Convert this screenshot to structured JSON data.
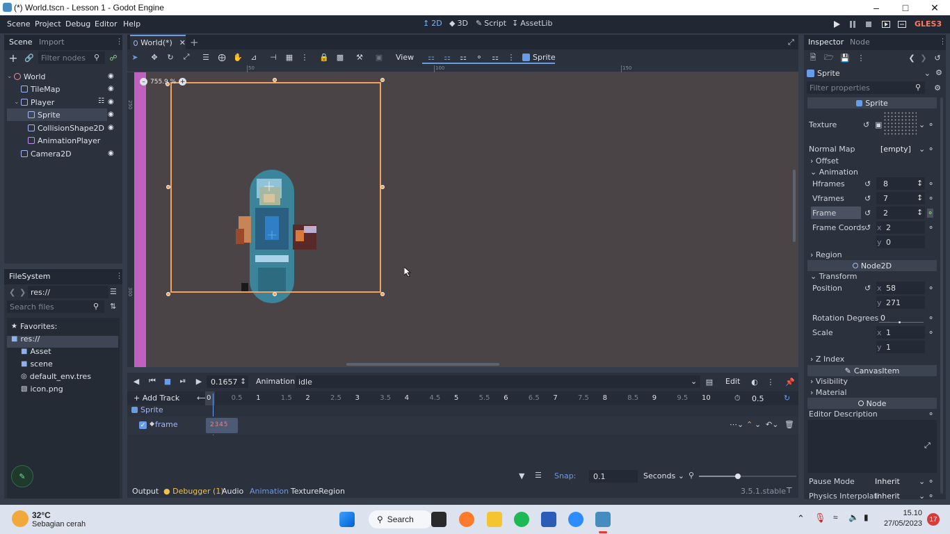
{
  "titlebar": {
    "title": "(*) World.tscn - Lesson 1 - Godot Engine"
  },
  "menu": {
    "items": [
      "Scene",
      "Project",
      "Debug",
      "Editor",
      "Help"
    ]
  },
  "workspaces": {
    "d2": "2D",
    "d3": "3D",
    "script": "Script",
    "assetlib": "AssetLib"
  },
  "renderer": "GLES3",
  "scene_dock": {
    "tabs": [
      "Scene",
      "Import"
    ],
    "filter_placeholder": "Filter nodes",
    "tree": [
      {
        "label": "World",
        "depth": 0,
        "icon": "node2d-icon",
        "color": "#ff8c9d"
      },
      {
        "label": "TileMap",
        "depth": 1,
        "icon": "tilemap-icon",
        "color": "#a5b7f3"
      },
      {
        "label": "Player",
        "depth": 1,
        "icon": "kinematic-body-icon",
        "color": "#a5b7f3"
      },
      {
        "label": "Sprite",
        "depth": 2,
        "icon": "sprite-icon",
        "color": "#a5b7f3"
      },
      {
        "label": "CollisionShape2D",
        "depth": 2,
        "icon": "collision-shape-icon",
        "color": "#a5b7f3"
      },
      {
        "label": "AnimationPlayer",
        "depth": 2,
        "icon": "animation-player-icon",
        "color": "#c38ef1"
      },
      {
        "label": "Camera2D",
        "depth": 1,
        "icon": "camera2d-icon",
        "color": "#a5b7f3"
      }
    ]
  },
  "filesystem": {
    "title": "FileSystem",
    "path": "res://",
    "search_placeholder": "Search files",
    "items": [
      {
        "label": "Favorites:",
        "icon": "star-icon"
      },
      {
        "label": "res://",
        "icon": "folder-icon"
      },
      {
        "label": "Asset",
        "icon": "folder-icon"
      },
      {
        "label": "scene",
        "icon": "folder-icon"
      },
      {
        "label": "default_env.tres",
        "icon": "environment-icon"
      },
      {
        "label": "icon.png",
        "icon": "image-icon"
      }
    ]
  },
  "editor_tab": {
    "label": "World(*)"
  },
  "toolbar": {
    "view_label": "View",
    "sprite_label": "Sprite"
  },
  "viewport": {
    "zoom": "755.9 %",
    "ruler_top": [
      "50",
      "100",
      "150"
    ],
    "ruler_left": [
      "250",
      "300"
    ]
  },
  "animation": {
    "time": "0.1657",
    "animation_label": "Animation",
    "animation_name": "idle",
    "edit_label": "Edit",
    "add_track": "Add Track",
    "timeline_ticks": [
      "0",
      "0.5",
      "1",
      "1.5",
      "2",
      "2.5",
      "3",
      "3.5",
      "4",
      "4.5",
      "5",
      "5.5",
      "6",
      "6.5",
      "7",
      "7.5",
      "8",
      "8.5",
      "9",
      "9.5",
      "10"
    ],
    "length": "0.5",
    "track_node": "Sprite",
    "track_property": "frame",
    "keyframes": "2 3 4 5",
    "snap_label": "Snap:",
    "snap_value": "0.1",
    "snap_unit": "Seconds",
    "zoom_level": 0.4
  },
  "bottom_tabs": {
    "output": "Output",
    "debugger": "Debugger (1)",
    "audio": "Audio",
    "animation": "Animation",
    "texture_region": "TextureRegion",
    "version": "3.5.1.stable"
  },
  "inspector": {
    "tabs": [
      "Inspector",
      "Node"
    ],
    "object": "Sprite",
    "filter_placeholder": "Filter properties",
    "class_sprite": "Sprite",
    "texture_label": "Texture",
    "normal_map_label": "Normal Map",
    "normal_map_value": "[empty]",
    "offset_label": "Offset",
    "animation_label": "Animation",
    "hframes_label": "Hframes",
    "hframes": "8",
    "vframes_label": "Vframes",
    "vframes": "7",
    "frame_label": "Frame",
    "frame": "2",
    "frame_coords_label": "Frame Coords",
    "frame_coords_x": "2",
    "frame_coords_y": "0",
    "region_label": "Region",
    "class_node2d": "Node2D",
    "transform_label": "Transform",
    "position_label": "Position",
    "position_x": "58",
    "position_y": "271",
    "rotation_label": "Rotation Degrees",
    "rotation": "0",
    "scale_label": "Scale",
    "scale_x": "1",
    "scale_y": "1",
    "zindex_label": "Z Index",
    "class_canvasitem": "CanvasItem",
    "visibility_label": "Visibility",
    "material_label": "Material",
    "class_node": "Node",
    "editor_desc_label": "Editor Description",
    "pause_mode_label": "Pause Mode",
    "pause_mode": "Inherit",
    "physics_interp_label": "Physics Interpolati",
    "physics_interp": "Inherit"
  },
  "taskbar": {
    "weather_temp": "32°C",
    "weather_desc": "Sebagian cerah",
    "search": "Search",
    "time": "15.10",
    "date": "27/05/2023",
    "notifications": "17"
  },
  "colors": {
    "accent": "#699ce8",
    "selection": "#f2a25c",
    "canvas_bg": "#4a4447",
    "panel": "#2b313d"
  }
}
